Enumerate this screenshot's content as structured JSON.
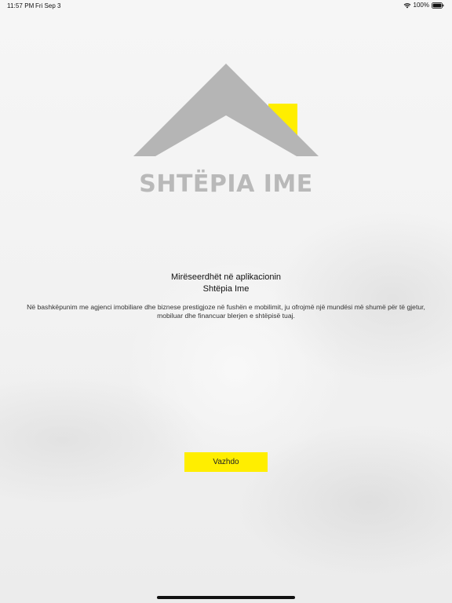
{
  "status_bar": {
    "time": "11:57 PM",
    "date": "Fri Sep 3",
    "battery": "100%"
  },
  "logo": {
    "text": "SHTËPIA IME",
    "roof_color": "#b5b5b5",
    "chimney_color": "#ffee00",
    "text_color": "#b9b9b9"
  },
  "welcome": {
    "title_line1": "Mirëseerdhët në aplikacionin",
    "title_line2": "Shtëpia Ime",
    "description": "Në bashkëpunim me agjenci imobiliare dhe biznese prestigjoze në fushën e mobilimit, ju ofrojmë një mundësi më shumë për të gjetur, mobiluar dhe financuar blerjen e shtëpisë tuaj."
  },
  "actions": {
    "continue_label": "Vazhdo",
    "button_color": "#ffee00"
  }
}
